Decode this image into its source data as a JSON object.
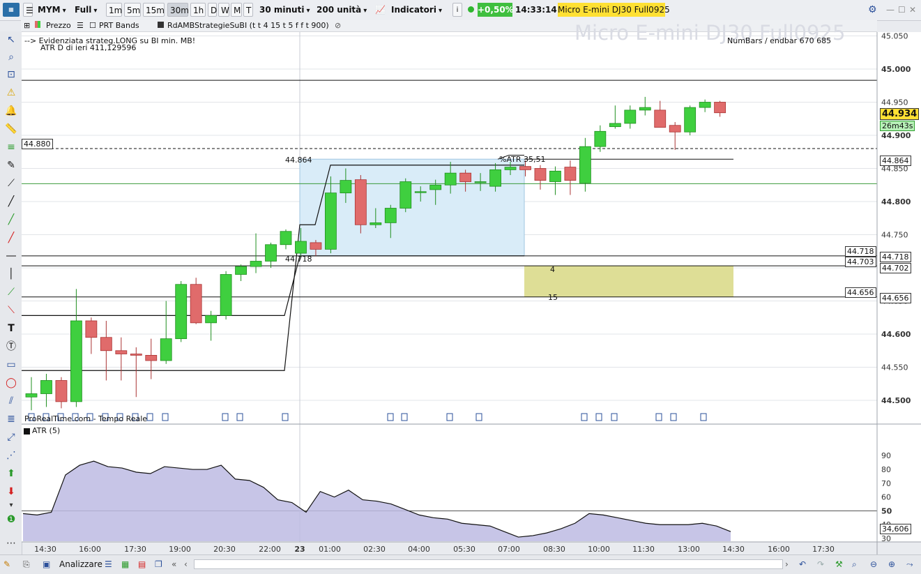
{
  "toolbar": {
    "symbol": "MYM",
    "mode": "Full",
    "timeframes": [
      "1m",
      "5m",
      "15m",
      "30m",
      "1h",
      "D",
      "W",
      "M",
      "T"
    ],
    "active_timeframe": "30m",
    "period": "30 minuti",
    "units": "200 unità",
    "indicators": "Indicatori",
    "change": "+0,50%",
    "time": "14:33:14",
    "instrument": "Micro E-mini DJ30 Full0925"
  },
  "legend": {
    "price": "Prezzo",
    "prt_bands": "PRT Bands",
    "strategy": "RdAMBStrategieSuBI (t t 4 15 t 5 f f t 900)"
  },
  "chart": {
    "watermark": "Micro E-mini DJ30 Full0925",
    "note_line1": "--> Evidenziata strateg.LONG su BI min. MB!",
    "note_line2": "ATR D di ieri 411,129596",
    "numbars": "NumBars / endbar 670  685",
    "source": "ProRealTime.com - Tempo Reale",
    "label_44864": "44.864",
    "label_44718": "44.718",
    "label_atr": "%ATR 35,51",
    "label_4": "4",
    "label_15": "15",
    "box_44880": "44.880",
    "box_44718": "44.718",
    "box_44703": "44.703",
    "box_44656": "44.656",
    "axis_44864": "44.864",
    "axis_44718": "44.718",
    "axis_44702": "44.702",
    "axis_44656": "44.656",
    "last_price": "44.934",
    "countdown": "26m43s",
    "atr_label": "ATR (5)",
    "atr_value": "34,606"
  },
  "bottom": {
    "analyze": "Analizzare"
  },
  "colors": {
    "up": "#3fcf3f",
    "down": "#e06b6b",
    "atr_fill": "#bdbbe3",
    "highlight_box": "#d9ecf8",
    "yellow_zone": "#dede96",
    "last_price_bg": "#ffe033",
    "countdown_bg": "#b7f0b7"
  },
  "chart_data": {
    "type": "candlestick",
    "title": "Micro E-mini DJ30 Full0925",
    "timeframe": "30 minuti",
    "y_ticks": [
      44500,
      44550,
      44600,
      44650,
      44700,
      44750,
      44800,
      44850,
      44900,
      44950,
      45000,
      45050
    ],
    "x_ticks": [
      "14:30",
      "16:00",
      "17:30",
      "19:00",
      "20:30",
      "22:00",
      "23",
      "01:00",
      "02:30",
      "04:00",
      "05:30",
      "07:00",
      "08:30",
      "10:00",
      "11:30",
      "13:00",
      "14:30",
      "16:00",
      "17:30"
    ],
    "ylim": [
      44465,
      45095
    ],
    "candles": [
      {
        "o": 44505,
        "h": 44535,
        "l": 44485,
        "c": 44510
      },
      {
        "o": 44510,
        "h": 44540,
        "l": 44490,
        "c": 44530
      },
      {
        "o": 44530,
        "h": 44535,
        "l": 44488,
        "c": 44498
      },
      {
        "o": 44498,
        "h": 44668,
        "l": 44490,
        "c": 44620
      },
      {
        "o": 44620,
        "h": 44625,
        "l": 44570,
        "c": 44595
      },
      {
        "o": 44595,
        "h": 44620,
        "l": 44530,
        "c": 44575
      },
      {
        "o": 44575,
        "h": 44595,
        "l": 44530,
        "c": 44570
      },
      {
        "o": 44570,
        "h": 44580,
        "l": 44505,
        "c": 44568
      },
      {
        "o": 44568,
        "h": 44593,
        "l": 44532,
        "c": 44560
      },
      {
        "o": 44560,
        "h": 44650,
        "l": 44555,
        "c": 44593
      },
      {
        "o": 44593,
        "h": 44680,
        "l": 44588,
        "c": 44675
      },
      {
        "o": 44675,
        "h": 44685,
        "l": 44615,
        "c": 44617
      },
      {
        "o": 44617,
        "h": 44635,
        "l": 44590,
        "c": 44628
      },
      {
        "o": 44628,
        "h": 44695,
        "l": 44622,
        "c": 44690
      },
      {
        "o": 44690,
        "h": 44705,
        "l": 44680,
        "c": 44702
      },
      {
        "o": 44702,
        "h": 44752,
        "l": 44692,
        "c": 44710
      },
      {
        "o": 44710,
        "h": 44738,
        "l": 44700,
        "c": 44735
      },
      {
        "o": 44735,
        "h": 44758,
        "l": 44728,
        "c": 44755
      },
      {
        "o": 44722,
        "h": 44760,
        "l": 44715,
        "c": 44740
      },
      {
        "o": 44738,
        "h": 44742,
        "l": 44718,
        "c": 44728
      },
      {
        "o": 44728,
        "h": 44838,
        "l": 44722,
        "c": 44813
      },
      {
        "o": 44813,
        "h": 44850,
        "l": 44798,
        "c": 44832
      },
      {
        "o": 44833,
        "h": 44840,
        "l": 44752,
        "c": 44765
      },
      {
        "o": 44765,
        "h": 44790,
        "l": 44760,
        "c": 44768
      },
      {
        "o": 44768,
        "h": 44795,
        "l": 44745,
        "c": 44790
      },
      {
        "o": 44790,
        "h": 44835,
        "l": 44784,
        "c": 44830
      },
      {
        "o": 44815,
        "h": 44823,
        "l": 44800,
        "c": 44815
      },
      {
        "o": 44818,
        "h": 44833,
        "l": 44795,
        "c": 44825
      },
      {
        "o": 44825,
        "h": 44860,
        "l": 44812,
        "c": 44843
      },
      {
        "o": 44843,
        "h": 44848,
        "l": 44815,
        "c": 44830
      },
      {
        "o": 44830,
        "h": 44843,
        "l": 44816,
        "c": 44830
      },
      {
        "o": 44823,
        "h": 44858,
        "l": 44815,
        "c": 44848
      },
      {
        "o": 44848,
        "h": 44860,
        "l": 44840,
        "c": 44852
      },
      {
        "o": 44853,
        "h": 44862,
        "l": 44838,
        "c": 44848
      },
      {
        "o": 44850,
        "h": 44855,
        "l": 44818,
        "c": 44832
      },
      {
        "o": 44830,
        "h": 44853,
        "l": 44810,
        "c": 44846
      },
      {
        "o": 44852,
        "h": 44862,
        "l": 44810,
        "c": 44832
      },
      {
        "o": 44828,
        "h": 44896,
        "l": 44815,
        "c": 44883
      },
      {
        "o": 44883,
        "h": 44915,
        "l": 44875,
        "c": 44906
      },
      {
        "o": 44913,
        "h": 44945,
        "l": 44910,
        "c": 44918
      },
      {
        "o": 44918,
        "h": 44945,
        "l": 44910,
        "c": 44938
      },
      {
        "o": 44938,
        "h": 44958,
        "l": 44930,
        "c": 44942
      },
      {
        "o": 44938,
        "h": 44952,
        "l": 44912,
        "c": 44912
      },
      {
        "o": 44915,
        "h": 44920,
        "l": 44878,
        "c": 44905
      },
      {
        "o": 44905,
        "h": 44945,
        "l": 44900,
        "c": 44942
      },
      {
        "o": 44942,
        "h": 44954,
        "l": 44935,
        "c": 44950
      },
      {
        "o": 44950,
        "h": 44952,
        "l": 44928,
        "c": 44934
      }
    ],
    "atr": [
      48,
      47,
      49,
      76,
      83,
      86,
      82,
      81,
      78,
      77,
      82,
      81,
      80,
      80,
      83,
      73,
      72,
      67,
      58,
      56,
      49,
      64,
      60,
      65,
      58,
      57,
      55,
      51,
      47,
      45,
      44,
      41,
      40,
      39,
      35,
      31,
      32,
      34,
      37,
      41,
      48,
      47,
      45,
      43,
      41,
      40,
      40,
      40,
      41,
      39,
      35
    ]
  }
}
